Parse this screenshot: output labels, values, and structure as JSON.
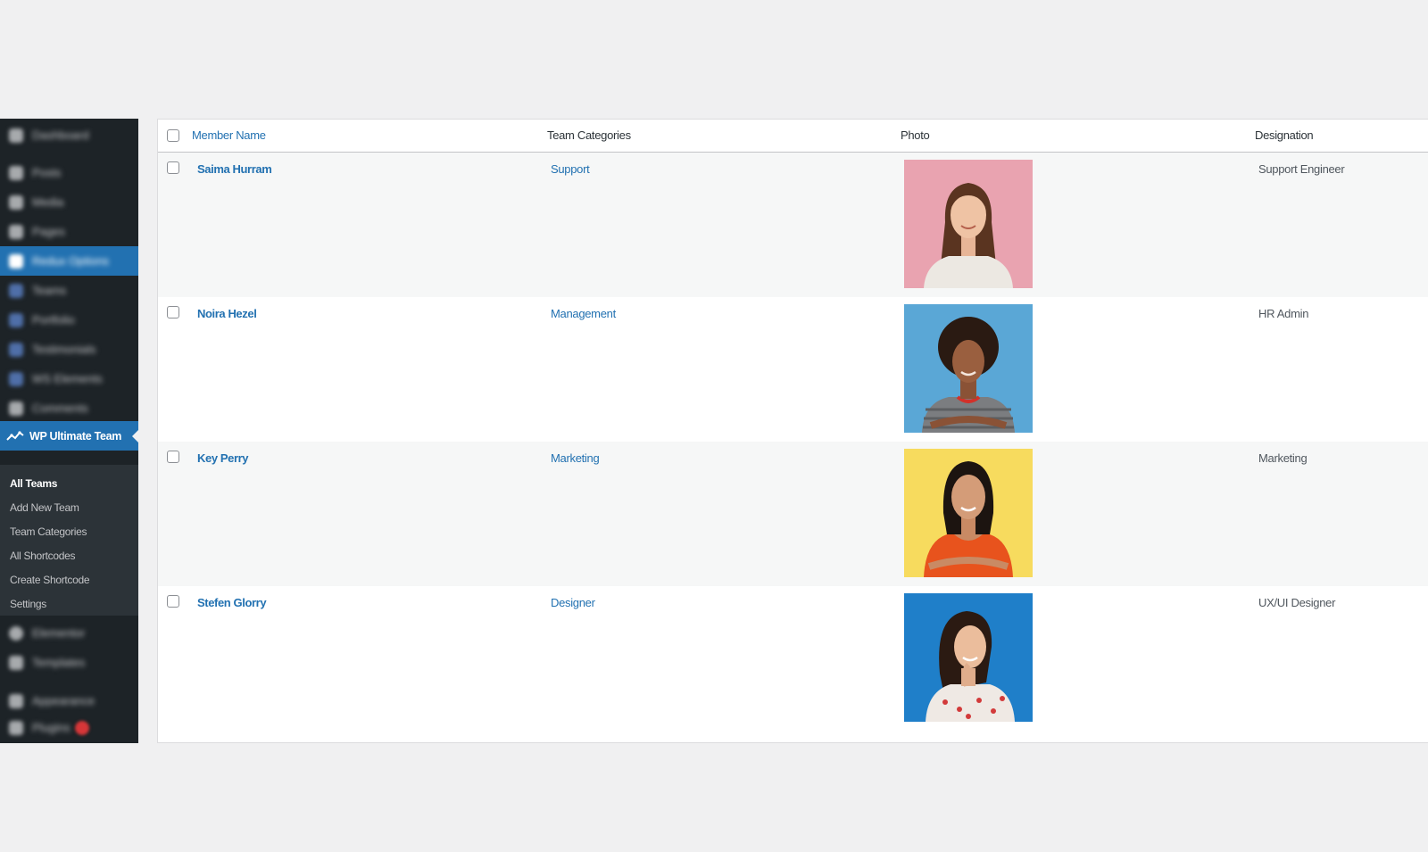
{
  "sidebar": {
    "blurred_items": [
      {
        "label": "Dashboard",
        "icon": "dashboard-icon"
      },
      {
        "label": "Posts",
        "icon": "pin-icon"
      },
      {
        "label": "Media",
        "icon": "media-icon"
      },
      {
        "label": "Pages",
        "icon": "pages-icon"
      },
      {
        "label": "Redux Options",
        "icon": "gear-icon"
      },
      {
        "label": "Teams",
        "icon": "grid-icon"
      },
      {
        "label": "Portfolio",
        "icon": "grid-icon"
      },
      {
        "label": "Testimonials",
        "icon": "grid-icon"
      },
      {
        "label": "WS Elements",
        "icon": "grid-icon"
      },
      {
        "label": "Comments",
        "icon": "comment-icon"
      },
      {
        "label": "Elementor",
        "icon": "elementor-icon"
      },
      {
        "label": "Templates",
        "icon": "folder-icon"
      },
      {
        "label": "Appearance",
        "icon": "brush-icon"
      },
      {
        "label": "Plugins",
        "icon": "plugin-icon"
      }
    ],
    "current_menu": {
      "label": "WP Ultimate Team",
      "icon": "team-chart-icon"
    },
    "submenu": [
      {
        "label": "All Teams"
      },
      {
        "label": "Add New Team"
      },
      {
        "label": "Team Categories"
      },
      {
        "label": "All Shortcodes"
      },
      {
        "label": "Create Shortcode"
      },
      {
        "label": "Settings"
      }
    ]
  },
  "table": {
    "columns": {
      "name": "Member Name",
      "categories": "Team Categories",
      "photo": "Photo",
      "designation": "Designation"
    },
    "rows": [
      {
        "name": "Saima Hurram",
        "category": "Support",
        "designation": "Support Engineer",
        "photo_bg": "#e9a3b0"
      },
      {
        "name": "Noira Hezel",
        "category": "Management",
        "designation": "HR Admin",
        "photo_bg": "#5aa7d6"
      },
      {
        "name": "Key Perry",
        "category": "Marketing",
        "designation": "Marketing",
        "photo_bg": "#f7db5e"
      },
      {
        "name": "Stefen Glorry",
        "category": "Designer",
        "designation": "UX/UI Designer",
        "photo_bg": "#1f7fc9"
      }
    ]
  },
  "colors": {
    "sidebar_bg": "#1d2327",
    "accent": "#2271b1",
    "link": "#2271b1"
  }
}
